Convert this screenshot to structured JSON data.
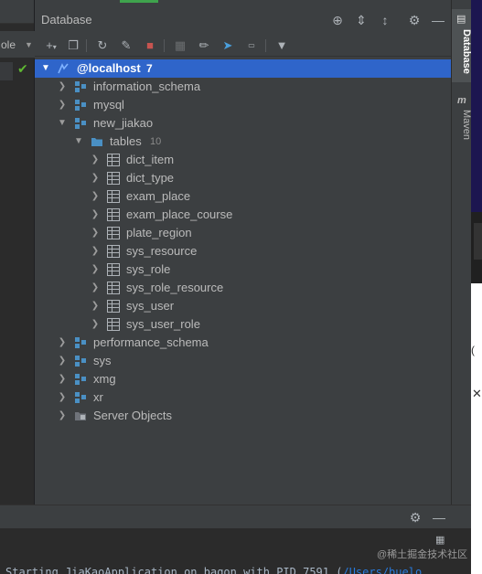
{
  "left_panel": {
    "dropdown_label": "ole"
  },
  "db_panel": {
    "title": "Database",
    "connection": {
      "name": "@localhost",
      "count": "7"
    },
    "tree": [
      {
        "label": "information_schema"
      },
      {
        "label": "mysql"
      },
      {
        "label": "new_jiakao"
      },
      {
        "label": "tables",
        "count": "10"
      },
      {
        "label": "dict_item"
      },
      {
        "label": "dict_type"
      },
      {
        "label": "exam_place"
      },
      {
        "label": "exam_place_course"
      },
      {
        "label": "plate_region"
      },
      {
        "label": "sys_resource"
      },
      {
        "label": "sys_role"
      },
      {
        "label": "sys_role_resource"
      },
      {
        "label": "sys_user"
      },
      {
        "label": "sys_user_role"
      },
      {
        "label": "performance_schema"
      },
      {
        "label": "sys"
      },
      {
        "label": "xmg"
      },
      {
        "label": "xr"
      },
      {
        "label": "Server Objects"
      }
    ]
  },
  "side_tabs": {
    "database": "Database",
    "maven": "Maven"
  },
  "console": {
    "log_text": "Starting JiaKaoApplication on bagon with PID 7591 (",
    "log_path": "/Users/buelo",
    "watermark": "@稀土掘金技术社区"
  },
  "icons": {
    "schema": "schema-icon",
    "folder": "folder-icon",
    "table": "table-icon",
    "connection": "mysql-connection-icon"
  },
  "colors": {
    "selection": "#2f65ca",
    "folder": "#4a90c4",
    "schema": "#5a8fc9",
    "success": "#5fb832",
    "stop": "#c75450"
  }
}
